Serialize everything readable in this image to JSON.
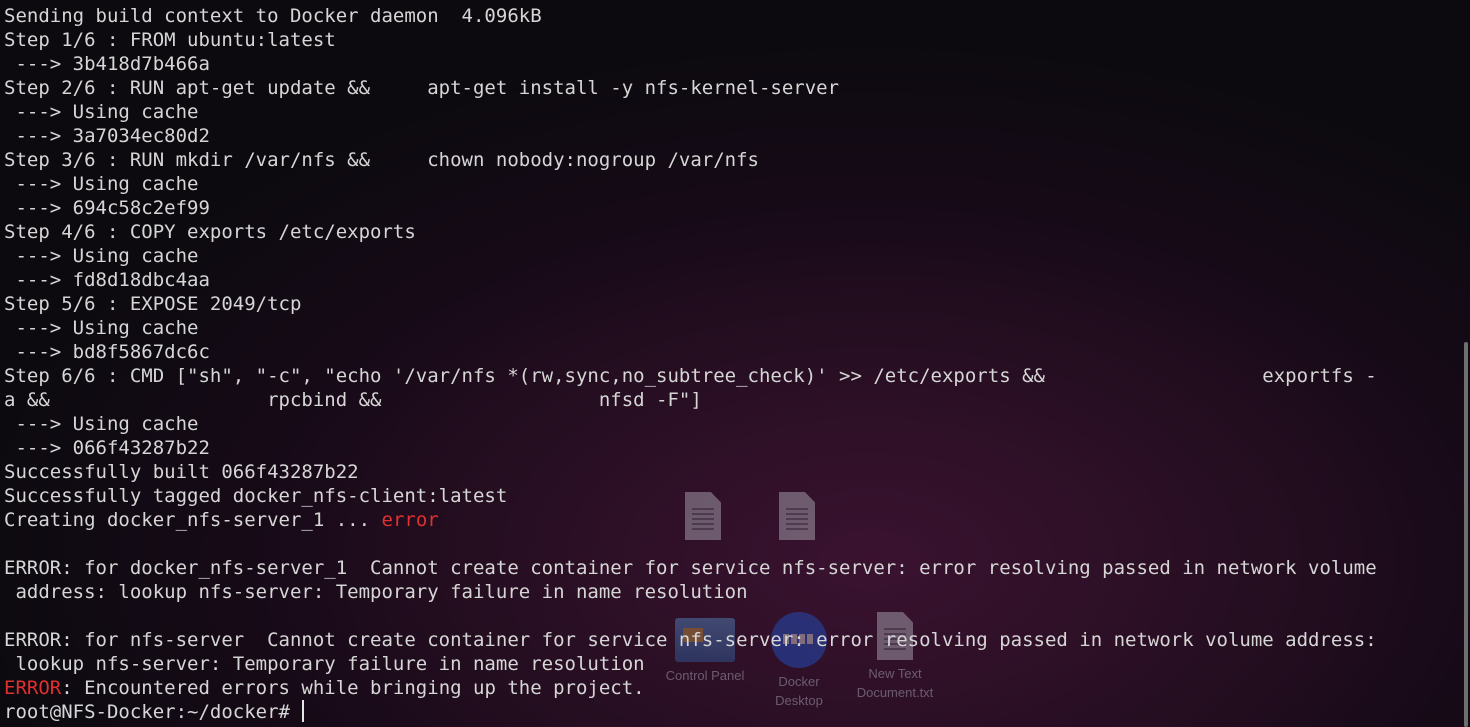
{
  "terminal": {
    "lines": [
      "Sending build context to Docker daemon  4.096kB",
      "Step 1/6 : FROM ubuntu:latest",
      " ---> 3b418d7b466a",
      "Step 2/6 : RUN apt-get update &&     apt-get install -y nfs-kernel-server",
      " ---> Using cache",
      " ---> 3a7034ec80d2",
      "Step 3/6 : RUN mkdir /var/nfs &&     chown nobody:nogroup /var/nfs",
      " ---> Using cache",
      " ---> 694c58c2ef99",
      "Step 4/6 : COPY exports /etc/exports",
      " ---> Using cache",
      " ---> fd8d18dbc4aa",
      "Step 5/6 : EXPOSE 2049/tcp",
      " ---> Using cache",
      " ---> bd8f5867dc6c",
      "Step 6/6 : CMD [\"sh\", \"-c\", \"echo '/var/nfs *(rw,sync,no_subtree_check)' >> /etc/exports &&                   exportfs -",
      "a &&                   rpcbind &&                   nfsd -F\"]",
      " ---> Using cache",
      " ---> 066f43287b22",
      "Successfully built 066f43287b22",
      "Successfully tagged docker_nfs-client:latest"
    ],
    "creating_prefix": "Creating docker_nfs-server_1 ... ",
    "creating_status": "error",
    "error1_line1": "ERROR: for docker_nfs-server_1  Cannot create container for service nfs-server: error resolving passed in network volume",
    "error1_line2": " address: lookup nfs-server: Temporary failure in name resolution",
    "error2_line1": "ERROR: for nfs-server  Cannot create container for service nfs-server: error resolving passed in network volume address:",
    "error2_line2": " lookup nfs-server: Temporary failure in name resolution",
    "final_error_tag": "ERROR",
    "final_error_msg": ": Encountered errors while bringing up the project.",
    "prompt": "root@NFS-Docker:~/docker#"
  },
  "desktop": {
    "icons": [
      {
        "name": "text-document-icon",
        "label": ""
      },
      {
        "name": "text-document-icon",
        "label": ""
      },
      {
        "name": "control-panel-icon",
        "label": "Control Panel"
      },
      {
        "name": "docker-desktop-icon",
        "label": "Docker Desktop"
      },
      {
        "name": "text-document-icon",
        "label": "New Text Document.txt"
      }
    ]
  },
  "colors": {
    "text": "#d6d6d6",
    "error": "#e0302f",
    "background": "#160a17"
  }
}
